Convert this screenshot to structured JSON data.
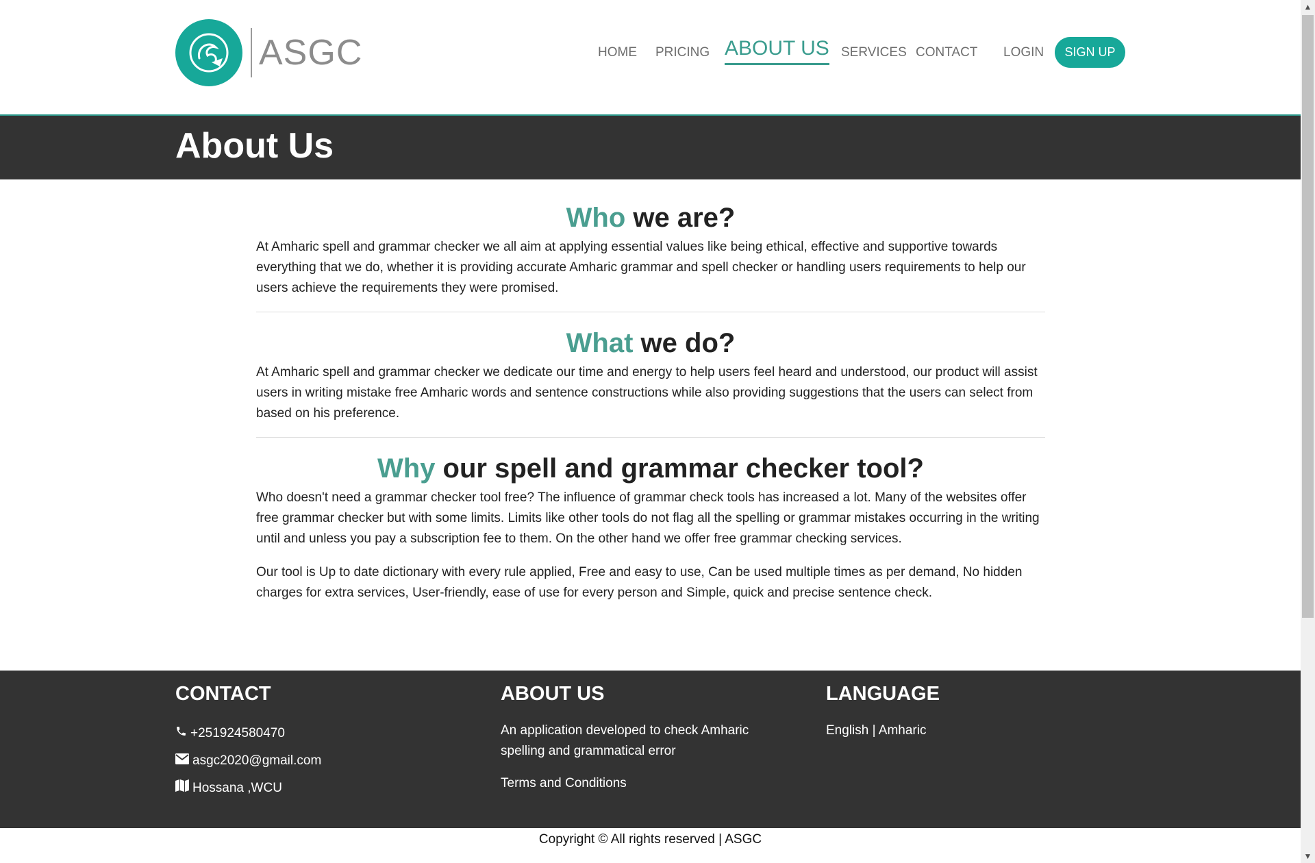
{
  "brand": {
    "name": "ASGC"
  },
  "nav": {
    "items": [
      {
        "label": "HOME"
      },
      {
        "label": "PRICING"
      },
      {
        "label": "ABOUT US"
      },
      {
        "label": "SERVICES"
      },
      {
        "label": "CONTACT"
      }
    ],
    "active": "ABOUT US",
    "login": "LOGIN",
    "signup": "SIGN UP"
  },
  "banner": {
    "title": "About Us"
  },
  "sections": [
    {
      "heading_accent": "Who",
      "heading_rest": " we are?",
      "paragraphs": [
        "At Amharic spell and grammar checker we all aim at applying essential values like being ethical, effective and supportive towards everything that we do, whether it is providing accurate Amharic grammar and spell checker or handling users requirements to help our users achieve the requirements they were promised."
      ]
    },
    {
      "heading_accent": "What",
      "heading_rest": " we do?",
      "paragraphs": [
        "At Amharic spell and grammar checker we dedicate our time and energy to help users feel heard and understood, our product will assist users in writing mistake free Amharic words and sentence constructions while also providing suggestions that the users can select from based on his preference."
      ]
    },
    {
      "heading_accent": "Why",
      "heading_rest": " our spell and grammar checker tool?",
      "paragraphs": [
        "Who doesn't need a grammar checker tool free? The influence of grammar check tools has increased a lot. Many of the websites offer free grammar checker but with some limits. Limits like other tools do not flag all the spelling or grammar mistakes occurring in the writing until and unless you pay a subscription fee to them. On the other hand we offer free grammar checking services.",
        "Our tool is Up to date dictionary with every rule applied, Free and easy to use, Can be used multiple times as per demand, No hidden charges for extra services, User-friendly, ease of use for every person and Simple, quick and precise sentence check."
      ]
    }
  ],
  "footer": {
    "contact": {
      "title": "CONTACT",
      "phone": "+251924580470",
      "email": "asgc2020@gmail.com",
      "location": "Hossana ,WCU",
      "icons": [
        "phone-icon",
        "envelope-icon",
        "map-icon"
      ]
    },
    "about": {
      "title": "ABOUT US",
      "description": "An application developed to check Amharic spelling and grammatical error",
      "terms": "Terms and Conditions"
    },
    "language": {
      "title": "LANGUAGE",
      "english": "English",
      "separator": " | ",
      "amharic": "Amharic"
    }
  },
  "copyright": "Copyright © All rights reserved | ASGC",
  "colors": {
    "accent": "#17a899",
    "heading_accent": "#4a9e90",
    "dark_band": "#333333"
  }
}
